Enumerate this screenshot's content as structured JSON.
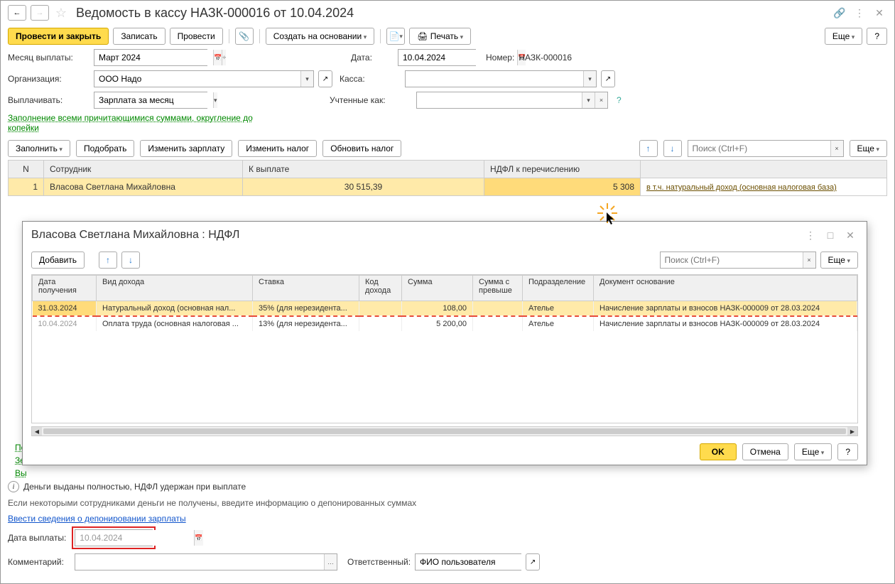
{
  "title": "Ведомость в кассу НАЗК-000016 от 10.04.2024",
  "toolbar": {
    "post_close": "Провести и закрыть",
    "save": "Записать",
    "post": "Провести",
    "create_based": "Создать на основании",
    "print": "Печать",
    "more": "Еще",
    "help": "?"
  },
  "form": {
    "month_label": "Месяц выплаты:",
    "month_value": "Март 2024",
    "org_label": "Организация:",
    "org_value": "ООО Надо",
    "pay_label": "Выплачивать:",
    "pay_value": "Зарплата за месяц",
    "date_label": "Дата:",
    "date_value": "10.04.2024",
    "number_label": "Номер:",
    "number_value": "НАЗК-000016",
    "kassa_label": "Касса:",
    "accounted_label": "Учтенные как:",
    "rounding_link": "Заполнение всеми причитающимися суммами, округление до копейки"
  },
  "actions": {
    "fill": "Заполнить",
    "pick": "Подобрать",
    "edit_salary": "Изменить зарплату",
    "edit_tax": "Изменить налог",
    "refresh_tax": "Обновить налог",
    "search_ph": "Поиск (Ctrl+F)",
    "more": "Еще"
  },
  "main_table": {
    "cols": {
      "n": "N",
      "emp": "Сотрудник",
      "pay": "К выплате",
      "ndfl": "НДФЛ к перечислению"
    },
    "row": {
      "n": "1",
      "emp": "Власова Светлана Михайловна",
      "pay": "30 515,39",
      "ndfl": "5 308",
      "link": "в т.ч. натуральный доход (основная налоговая база)"
    }
  },
  "modal": {
    "title": "Власова Светлана Михайловна : НДФЛ",
    "add": "Добавить",
    "search_ph": "Поиск (Ctrl+F)",
    "more": "Еще",
    "cols": {
      "date": "Дата получения",
      "kind": "Вид дохода",
      "rate": "Ставка",
      "code": "Код дохода",
      "sum": "Сумма",
      "sum_ex": "Сумма с превыше",
      "dept": "Подразделение",
      "doc": "Документ основание"
    },
    "rows": [
      {
        "date": "31.03.2024",
        "kind": "Натуральный доход (основная нал...",
        "rate": "35% (для нерезидента...",
        "code": "",
        "sum": "108,00",
        "sum_ex": "",
        "dept": "Ателье",
        "doc": "Начисление зарплаты и взносов НАЗК-000009 от 28.03.2024"
      },
      {
        "date": "10.04.2024",
        "kind": "Оплата труда (основная налоговая ...",
        "rate": "13% (для нерезидента...",
        "code": "",
        "sum": "5 200,00",
        "sum_ex": "",
        "dept": "Ателье",
        "doc": "Начисление зарплаты и взносов НАЗК-000009 от 28.03.2024"
      }
    ],
    "ok": "OK",
    "cancel": "Отмена",
    "more2": "Еще",
    "help": "?"
  },
  "footer": {
    "link1": "По",
    "link2": "Зе",
    "link3": "Вы",
    "info": "Деньги выданы полностью, НДФЛ удержан при выплате",
    "deposit_info": "Если некоторыми сотрудниками деньги не получены, введите информацию о депонированных суммах",
    "deposit_link": "Ввести сведения о депонировании зарплаты",
    "pay_date_label": "Дата выплаты:",
    "pay_date_value": "10.04.2024",
    "comment_label": "Комментарий:",
    "responsible_label": "Ответственный:",
    "responsible_value": "ФИО пользователя"
  }
}
